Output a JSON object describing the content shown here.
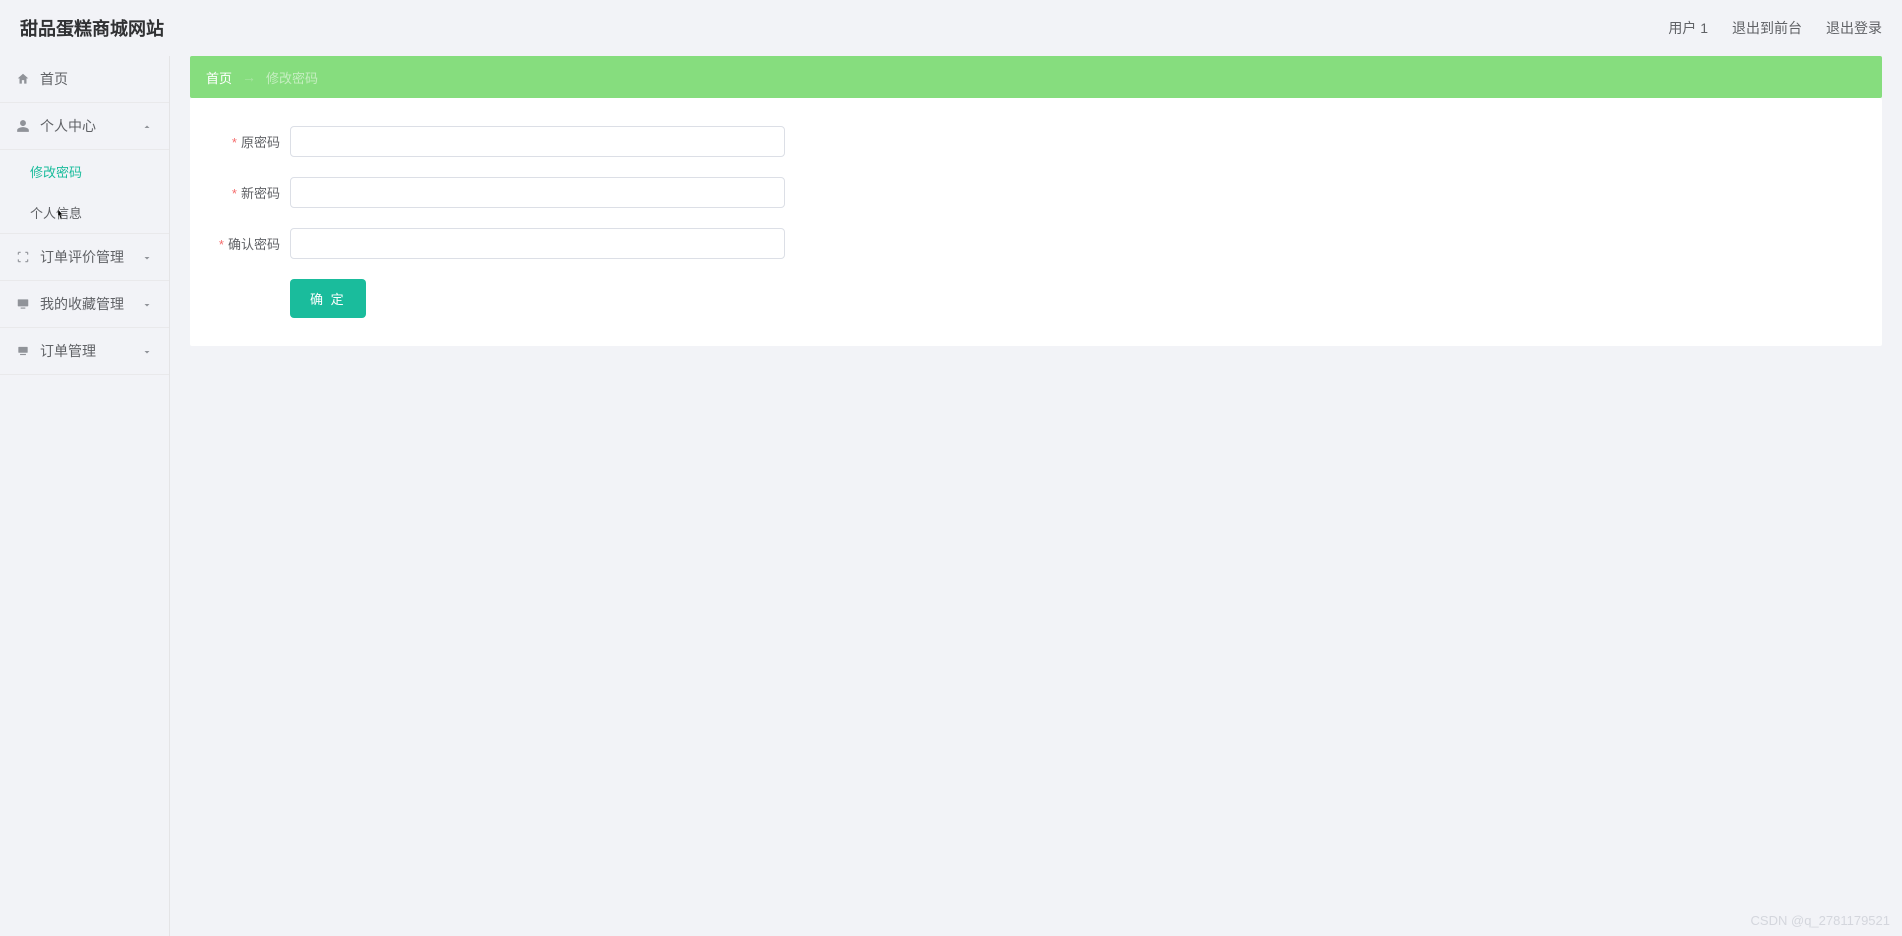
{
  "header": {
    "logo": "甜品蛋糕商城网站",
    "user_label": "用户 1",
    "exit_front_label": "退出到前台",
    "logout_label": "退出登录"
  },
  "sidebar": {
    "home_label": "首页",
    "personal_center_label": "个人中心",
    "change_password_label": "修改密码",
    "personal_info_label": "个人信息",
    "order_review_label": "订单评价管理",
    "my_favorites_label": "我的收藏管理",
    "order_mgmt_label": "订单管理"
  },
  "breadcrumb": {
    "home": "首页",
    "current": "修改密码"
  },
  "form": {
    "old_password_label": "原密码",
    "new_password_label": "新密码",
    "confirm_password_label": "确认密码",
    "submit_label": "确 定"
  },
  "watermark": "CSDN @q_2781179521"
}
